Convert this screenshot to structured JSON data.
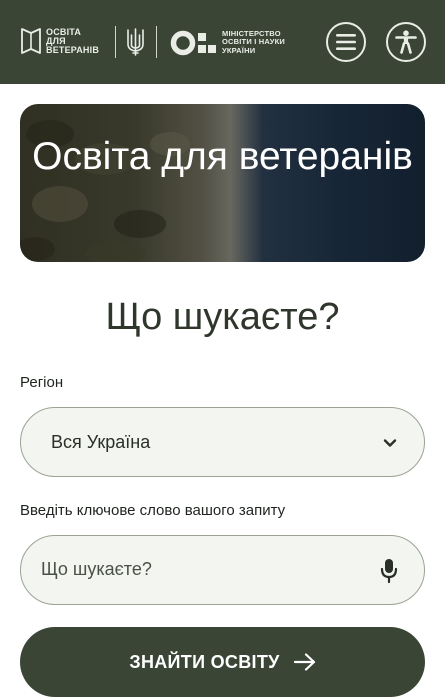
{
  "header": {
    "logo_lines": [
      "ОСВІТА",
      "ДЛЯ",
      "ВЕТЕРАНІВ"
    ],
    "ministry_lines": [
      "МІНІСТЕРСТВО",
      "ОСВІТИ І НАУКИ",
      "УКРАЇНИ"
    ],
    "icons": {
      "logo": "book-outline-icon",
      "trident": "coat-of-arms-trident-icon",
      "ministry": "ministry-logo-mark",
      "menu": "hamburger-menu-icon",
      "accessibility": "accessibility-person-icon"
    }
  },
  "hero": {
    "title": "Освіта для ветеранів"
  },
  "search": {
    "heading": "Що шукаєте?",
    "region_label": "Регіон",
    "region_value": "Вся Україна",
    "keyword_label": "Введіть ключове слово вашого запиту",
    "keyword_placeholder": "Що шукаєте?",
    "submit_label": "ЗНАЙТИ ОСВІТУ",
    "icons": {
      "dropdown": "chevron-down-icon",
      "voice": "microphone-icon",
      "submit": "arrow-right-icon"
    }
  },
  "colors": {
    "brand_dark": "#3a4536",
    "header_text": "#e9ede6",
    "field_border": "#9aa395",
    "field_bg": "#f3f5f1"
  }
}
